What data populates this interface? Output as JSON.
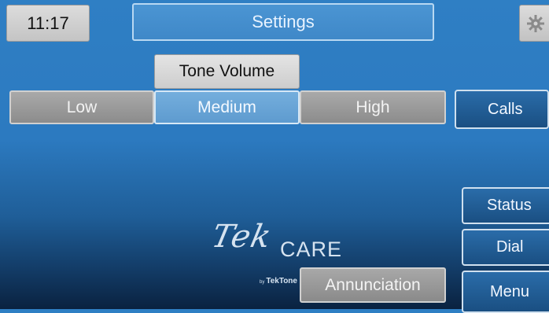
{
  "header": {
    "time": "11:17",
    "title": "Settings",
    "settings_icon": "gear-icon"
  },
  "tone_volume": {
    "label": "Tone Volume",
    "options": [
      "Low",
      "Medium",
      "High"
    ],
    "selected": "Medium"
  },
  "nav": {
    "calls": "Calls",
    "status": "Status",
    "dial": "Dial",
    "menu": "Menu"
  },
  "logo": {
    "tek": "Tek",
    "care": "CARE",
    "by_prefix": "by",
    "by_brand": "TekTone"
  },
  "footer": {
    "annunciation": "Annunciation"
  },
  "colors": {
    "background_top": "#2f7fc4",
    "background_bottom": "#0a2240",
    "selected_option": "#5e9bcf",
    "unselected_option": "#8c8c8c"
  }
}
